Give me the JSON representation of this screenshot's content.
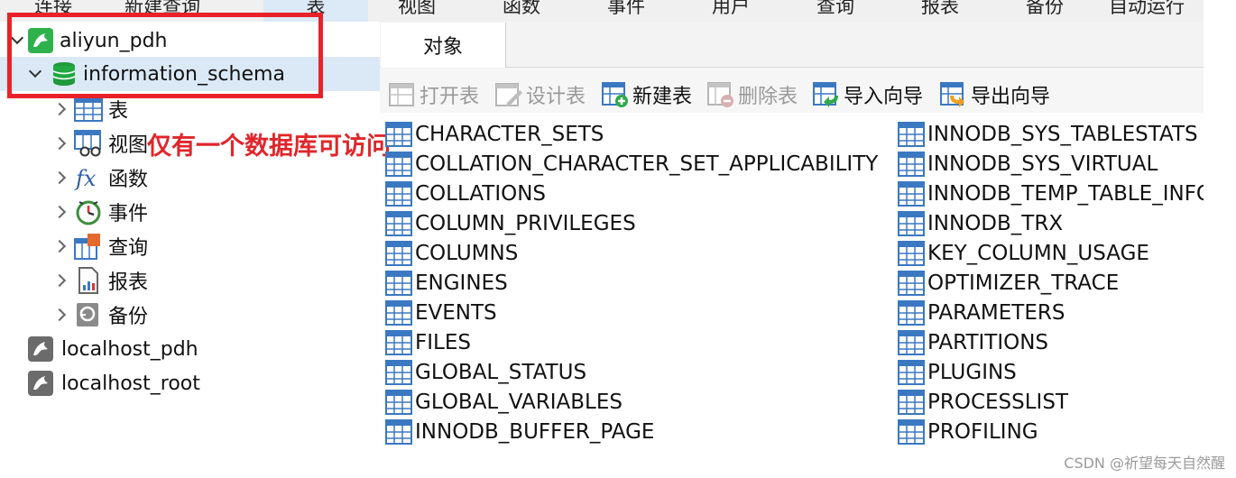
{
  "topbar": {
    "items": [
      {
        "label": "连接"
      },
      {
        "label": "新建查询"
      },
      {
        "label": "表"
      },
      {
        "label": "视图"
      },
      {
        "label": "函数"
      },
      {
        "label": "事件"
      },
      {
        "label": "用户"
      },
      {
        "label": "查询"
      },
      {
        "label": "报表"
      },
      {
        "label": "备份"
      },
      {
        "label": "自动运行"
      }
    ]
  },
  "sidebar": {
    "connections": [
      {
        "name": "aliyun_pdh"
      },
      {
        "name": "localhost_pdh"
      },
      {
        "name": "localhost_root"
      }
    ],
    "database": "information_schema",
    "nodes": [
      {
        "label": "表",
        "icon": "table-icon"
      },
      {
        "label": "视图",
        "icon": "view-icon"
      },
      {
        "label": "函数",
        "icon": "function-icon"
      },
      {
        "label": "事件",
        "icon": "clock-icon"
      },
      {
        "label": "查询",
        "icon": "query-icon"
      },
      {
        "label": "报表",
        "icon": "report-icon"
      },
      {
        "label": "备份",
        "icon": "backup-icon"
      }
    ]
  },
  "annotation": {
    "text": "仅有一个数据库可访问",
    "color": "#e0262b"
  },
  "tab": {
    "label": "对象"
  },
  "toolbar": {
    "open": "打开表",
    "design": "设计表",
    "new": "新建表",
    "delete": "删除表",
    "import": "导入向导",
    "export": "导出向导"
  },
  "tables": {
    "left": [
      "CHARACTER_SETS",
      "COLLATION_CHARACTER_SET_APPLICABILITY",
      "COLLATIONS",
      "COLUMN_PRIVILEGES",
      "COLUMNS",
      "ENGINES",
      "EVENTS",
      "FILES",
      "GLOBAL_STATUS",
      "GLOBAL_VARIABLES",
      "INNODB_BUFFER_PAGE"
    ],
    "right": [
      "INNODB_SYS_TABLESTATS",
      "INNODB_SYS_VIRTUAL",
      "INNODB_TEMP_TABLE_INFO",
      "INNODB_TRX",
      "KEY_COLUMN_USAGE",
      "OPTIMIZER_TRACE",
      "PARAMETERS",
      "PARTITIONS",
      "PLUGINS",
      "PROCESSLIST",
      "PROFILING"
    ]
  },
  "watermark": "CSDN @祈望每天自然醒",
  "colors": {
    "accent": "#dbe9f7",
    "highlight": "#e8222a"
  }
}
